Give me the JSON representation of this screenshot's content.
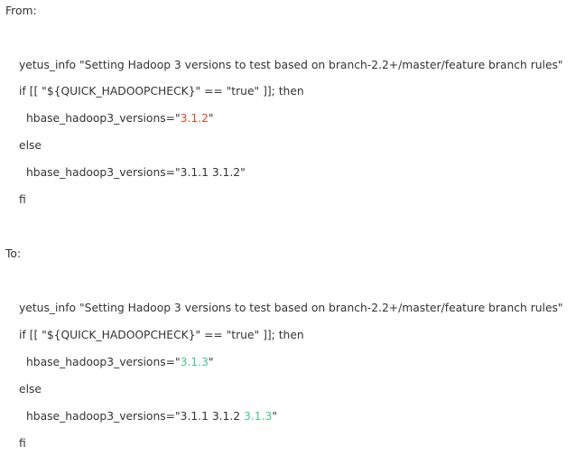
{
  "from_label": "From:",
  "to_label": "To:",
  "from": {
    "line1": "yetus_info \"Setting Hadoop 3 versions to test based on branch-2.2+/master/feature branch rules\"",
    "line2": "if [[ \"${QUICK_HADOOPCHECK}\" == \"true\" ]]; then",
    "line3_prefix": "hbase_hadoop3_versions=\"",
    "line3_version": "3.1.2",
    "line3_suffix": "\"",
    "line4": "else",
    "line5": "hbase_hadoop3_versions=\"3.1.1 3.1.2\"",
    "line6": "fi"
  },
  "to": {
    "line1": "yetus_info \"Setting Hadoop 3 versions to test based on branch-2.2+/master/feature branch rules\"",
    "line2": "if [[ \"${QUICK_HADOOPCHECK}\" == \"true\" ]]; then",
    "line3_prefix": "hbase_hadoop3_versions=\"",
    "line3_version": "3.1.3",
    "line3_suffix": "\"",
    "line4": "else",
    "line5_prefix": "hbase_hadoop3_versions=\"3.1.1 3.1.2 ",
    "line5_version": "3.1.3",
    "line5_suffix": "\"",
    "line6": "fi"
  },
  "colors": {
    "text": "#333333",
    "removed_version": "#e0491b",
    "added_version": "#3fc98a"
  }
}
